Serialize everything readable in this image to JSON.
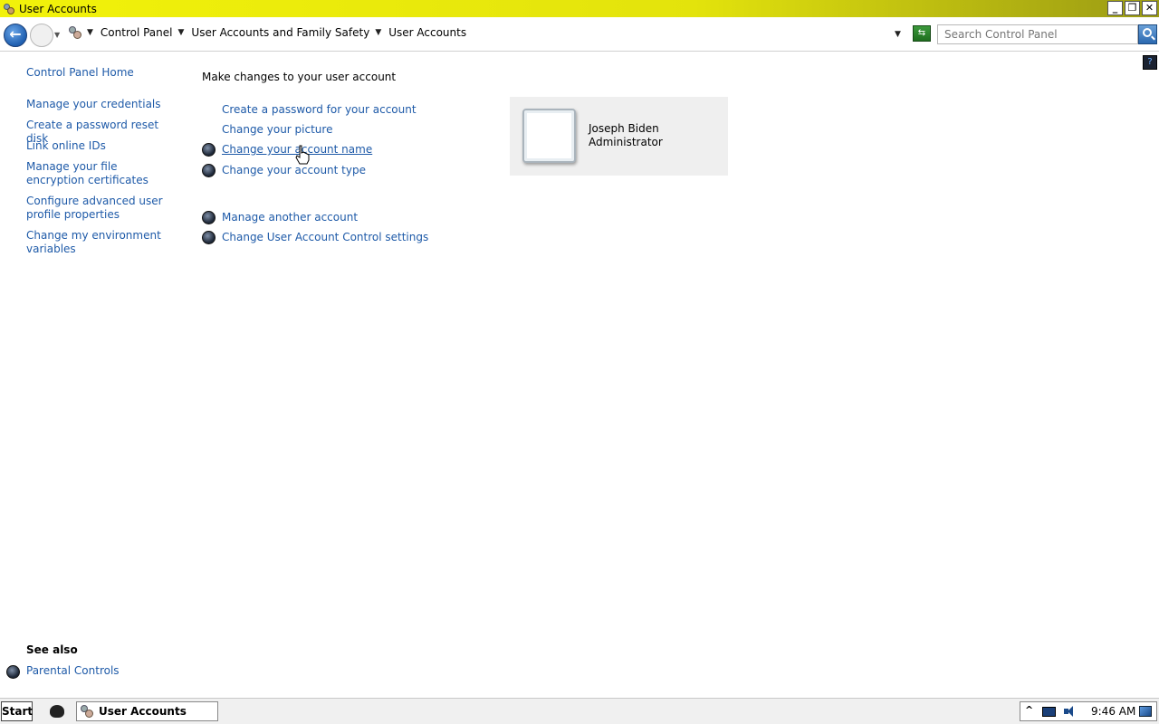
{
  "window": {
    "title": "User Accounts",
    "buttons": {
      "minimize": "_",
      "restore": "❐",
      "close": "✕"
    }
  },
  "address_bar": {
    "breadcrumbs": [
      "Control Panel",
      "User Accounts and Family Safety",
      "User Accounts"
    ],
    "search_placeholder": "Search Control Panel"
  },
  "left_pane": {
    "home": "Control Panel Home",
    "links": [
      "Manage your credentials",
      "Create a password reset disk",
      "Link online IDs",
      "Manage your file encryption certificates",
      "Configure advanced user profile properties",
      "Change my environment variables"
    ],
    "see_also_heading": "See also",
    "see_also_links": [
      "Parental Controls"
    ]
  },
  "main": {
    "heading": "Make changes to your user account",
    "tasks": [
      {
        "label": "Create a password for your account",
        "shield": false
      },
      {
        "label": "Change your picture",
        "shield": false
      },
      {
        "label": "Change your account name",
        "shield": true,
        "hovered": true
      },
      {
        "label": "Change your account type",
        "shield": true
      },
      {
        "label": "Manage another account",
        "shield": true
      },
      {
        "label": "Change User Account Control settings",
        "shield": true
      }
    ],
    "account": {
      "name": "Joseph Biden",
      "role": "Administrator"
    }
  },
  "taskbar": {
    "start": "Start",
    "active_window": "User Accounts",
    "clock": "9:46 AM",
    "tray_icons": [
      "show-hidden-icon",
      "network-icon",
      "volume-icon",
      "action-center-flag-icon"
    ]
  }
}
